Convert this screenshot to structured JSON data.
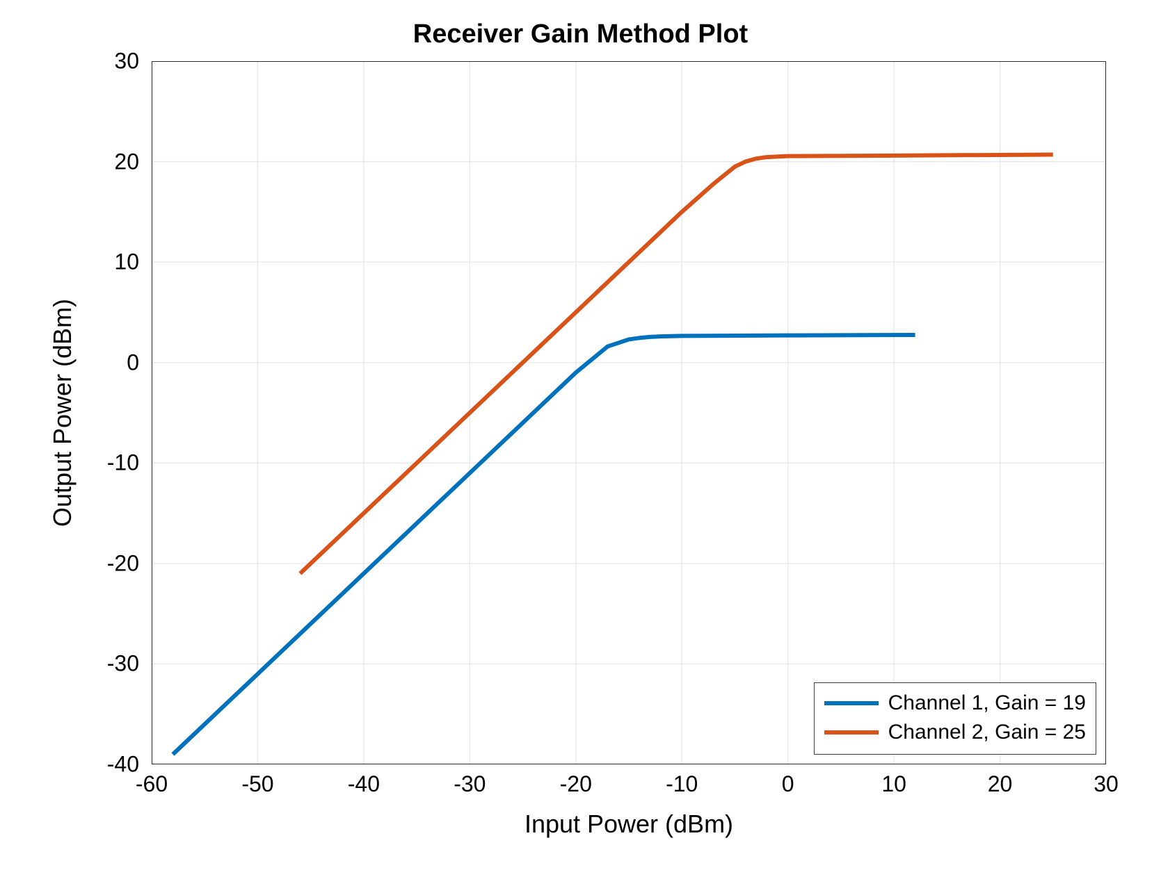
{
  "chart_data": {
    "type": "line",
    "title": "Receiver Gain Method Plot",
    "xlabel": "Input Power (dBm)",
    "ylabel": "Output Power (dBm)",
    "xlim": [
      -60,
      30
    ],
    "ylim": [
      -40,
      30
    ],
    "xticks": [
      -60,
      -50,
      -40,
      -30,
      -20,
      -10,
      0,
      10,
      20,
      30
    ],
    "yticks": [
      -40,
      -30,
      -20,
      -10,
      0,
      10,
      20,
      30
    ],
    "grid": true,
    "legend_position": "lower right",
    "series": [
      {
        "name": "Channel 1, Gain = 19",
        "color": "#0072BD",
        "x": [
          -58,
          -50,
          -40,
          -30,
          -20,
          -17,
          -15,
          -14,
          -13,
          -12,
          -10,
          0,
          12
        ],
        "y": [
          -39,
          -31,
          -21,
          -11,
          -1,
          1.6,
          2.3,
          2.45,
          2.55,
          2.6,
          2.65,
          2.7,
          2.75
        ]
      },
      {
        "name": "Channel 2, Gain = 25",
        "color": "#D95319",
        "x": [
          -46,
          -40,
          -30,
          -20,
          -10,
          -7,
          -5,
          -4,
          -3,
          -2,
          0,
          10,
          25
        ],
        "y": [
          -21,
          -15,
          -5,
          5,
          15,
          17.8,
          19.5,
          20.0,
          20.3,
          20.45,
          20.55,
          20.6,
          20.7
        ]
      }
    ]
  }
}
